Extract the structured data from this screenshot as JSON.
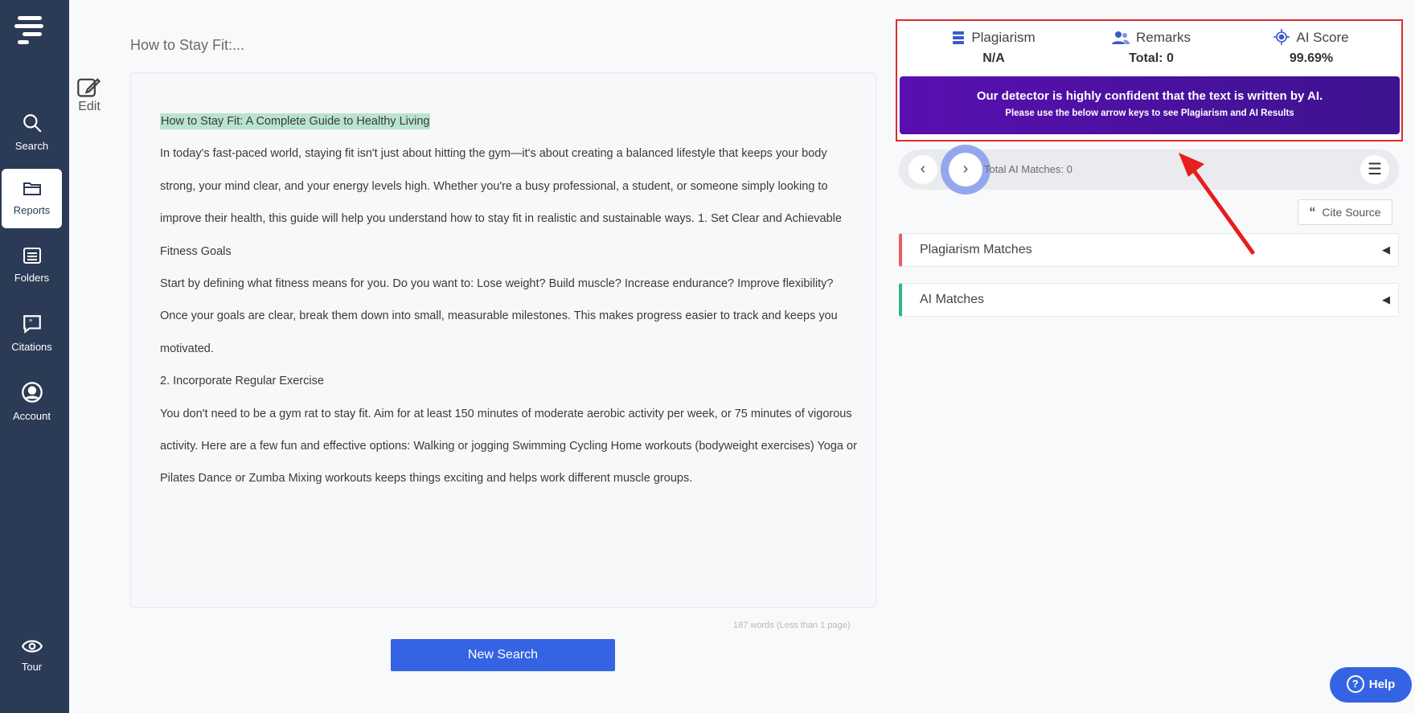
{
  "sidebar": {
    "items": [
      {
        "label": "Search",
        "icon": "search-icon"
      },
      {
        "label": "Reports",
        "icon": "folder-icon",
        "active": true
      },
      {
        "label": "Folders",
        "icon": "list-icon"
      },
      {
        "label": "Citations",
        "icon": "quote-icon"
      },
      {
        "label": "Account",
        "icon": "user-icon"
      },
      {
        "label": "Tour",
        "icon": "eye-icon"
      }
    ]
  },
  "document": {
    "title": "How to Stay Fit:...",
    "edit_label": "Edit",
    "highlight": "How to Stay Fit: A Complete Guide to Healthy Living",
    "paragraphs": [
      "In today's fast-paced world, staying fit isn't just about hitting the gym—it's about creating a balanced lifestyle that keeps your body strong, your mind clear, and your energy levels high. Whether you're a busy professional, a student, or someone simply looking to improve their health, this guide will help you understand how to stay fit in realistic and sustainable ways. 1. Set Clear and Achievable Fitness Goals",
      "Start by defining what fitness means for you. Do you want to: Lose weight? Build muscle? Increase endurance? Improve flexibility? Once your goals are clear, break them down into small, measurable milestones. This makes progress easier to track and keeps you motivated.",
      "2. Incorporate Regular Exercise",
      "You don't need to be a gym rat to stay fit. Aim for at least 150 minutes of moderate aerobic activity per week, or 75 minutes of vigorous activity. Here are a few fun and effective options: Walking or jogging Swimming Cycling Home workouts (bodyweight exercises) Yoga or Pilates Dance or Zumba Mixing workouts keeps things exciting and helps work different muscle groups."
    ],
    "word_count": "187 words (Less than 1 page)",
    "new_search_label": "New Search"
  },
  "scores": {
    "plagiarism": {
      "label": "Plagiarism",
      "value": "N/A"
    },
    "remarks": {
      "label": "Remarks",
      "value": "Total: 0"
    },
    "ai_score": {
      "label": "AI Score",
      "value": "99.69%"
    },
    "banner_main": "Our detector is highly confident that the text is written by AI.",
    "banner_sub": "Please use the below arrow keys to see Plagiarism and AI Results"
  },
  "navigation": {
    "total_ai_matches": "Total AI Matches: 0"
  },
  "cite_source_label": "Cite Source",
  "accordions": {
    "plagiarism_matches": "Plagiarism Matches",
    "ai_matches": "AI Matches"
  },
  "help_label": "Help",
  "colors": {
    "sidebar_bg": "#2b3a55",
    "accent_blue": "#3464e3",
    "banner_purple": "#4a11a0",
    "highlight_red": "#e02b2b",
    "plag_marker": "#e95d62",
    "ai_marker": "#2fb58b"
  }
}
